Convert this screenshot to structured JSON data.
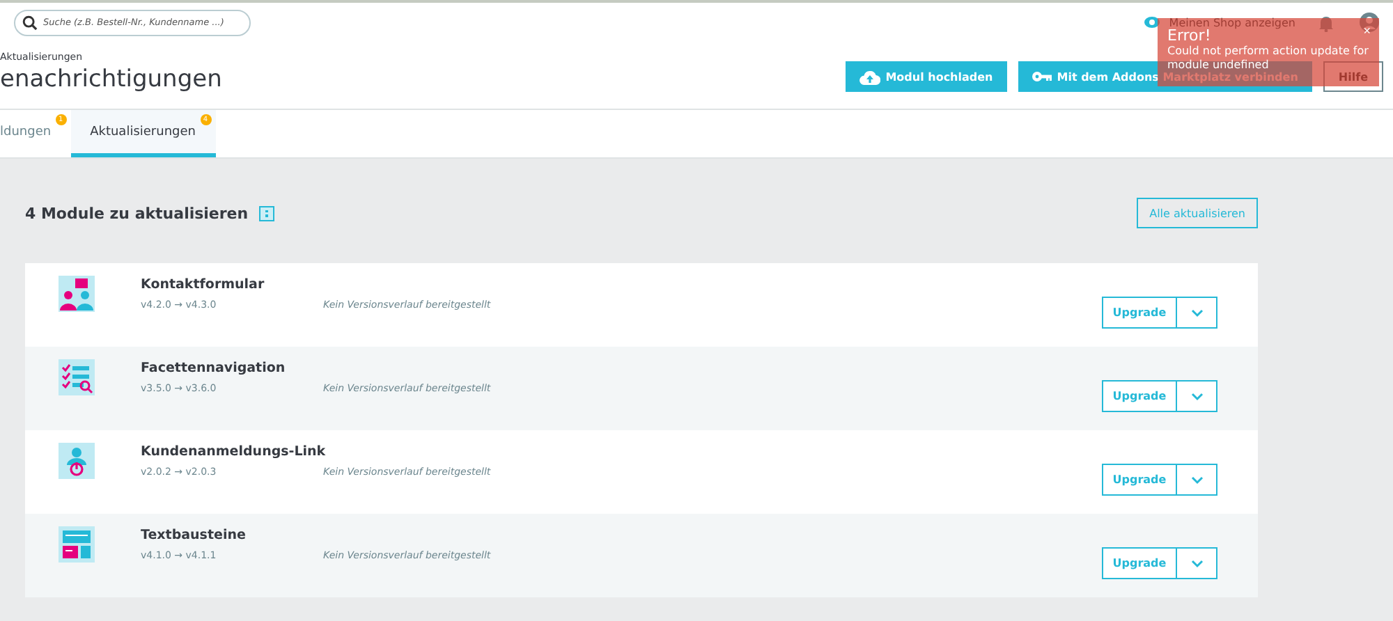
{
  "search": {
    "placeholder": "Suche (z.B. Bestell-Nr., Kundenname ...)"
  },
  "shop_link": "Meinen Shop anzeigen",
  "breadcrumb": "Aktualisierungen",
  "title": "enachrichtigungen",
  "toolbar_buttons": [
    {
      "label": "Modul hochladen",
      "kind": "upload"
    },
    {
      "label": "Mit dem Addons Marktplatz verbinden",
      "kind": "key"
    },
    {
      "label": "Hilfe",
      "kind": "outline"
    }
  ],
  "tabs": [
    {
      "label": "ldungen",
      "badge": "1",
      "selected": false
    },
    {
      "label": "Aktualisierungen",
      "badge": "4",
      "selected": true
    }
  ],
  "section": {
    "heading": "4 Module zu aktualisieren",
    "update_all": "Alle aktualisieren"
  },
  "modules": [
    {
      "name": "Kontaktformular",
      "versions": "v4.2.0 → v4.3.0",
      "changelog": "Kein Versionsverlauf bereitgestellt",
      "action": "Upgrade",
      "kind": "contact"
    },
    {
      "name": "Facettennavigation",
      "versions": "v3.5.0 → v3.6.0",
      "changelog": "Kein Versionsverlauf bereitgestellt",
      "action": "Upgrade",
      "kind": "facets"
    },
    {
      "name": "Kundenanmeldungs-Link",
      "versions": "v2.0.2 → v2.0.3",
      "changelog": "Kein Versionsverlauf bereitgestellt",
      "action": "Upgrade",
      "kind": "login"
    },
    {
      "name": "Textbausteine",
      "versions": "v4.1.0 → v4.1.1",
      "changelog": "Kein Versionsverlauf bereitgestellt",
      "action": "Upgrade",
      "kind": "blocks"
    }
  ],
  "toast": {
    "title": "Error!",
    "message": "Could not perform action update for module undefined",
    "close": "×"
  }
}
